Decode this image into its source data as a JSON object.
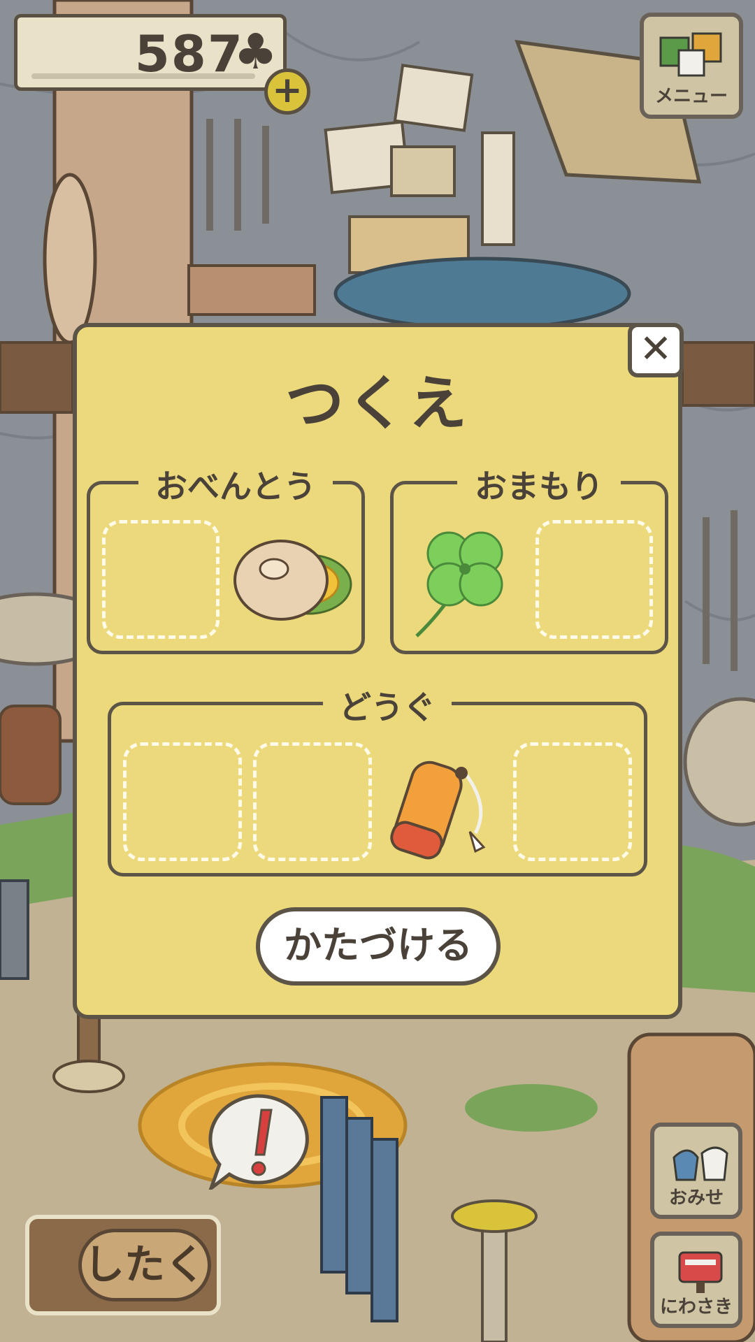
{
  "colors": {
    "dialog_bg": "#ecd97c",
    "border": "#5c5446",
    "text": "#4a4238",
    "slot_dash": "#fffbe8",
    "scene_bg": "#8a8f94"
  },
  "currency": {
    "amount": "587",
    "symbol": "♣",
    "add_label": "+"
  },
  "menu": {
    "label": "メニュー"
  },
  "dialog": {
    "title": "つくえ",
    "close_label": "✕",
    "groups": {
      "bento": {
        "label": "おべんとう",
        "items": [
          "empty",
          "bagel-sandwich-icon"
        ]
      },
      "charm": {
        "label": "おまもり",
        "items": [
          "four-leaf-clover-icon",
          "empty"
        ]
      },
      "tool": {
        "label": "どうぐ",
        "items": [
          "empty",
          "empty",
          "orange-pouch-icon",
          "empty"
        ]
      }
    },
    "put_away_label": "かたづける"
  },
  "bottom": {
    "prepare_label": "したく",
    "shop_label": "おみせ",
    "garden_label": "にわさき"
  }
}
